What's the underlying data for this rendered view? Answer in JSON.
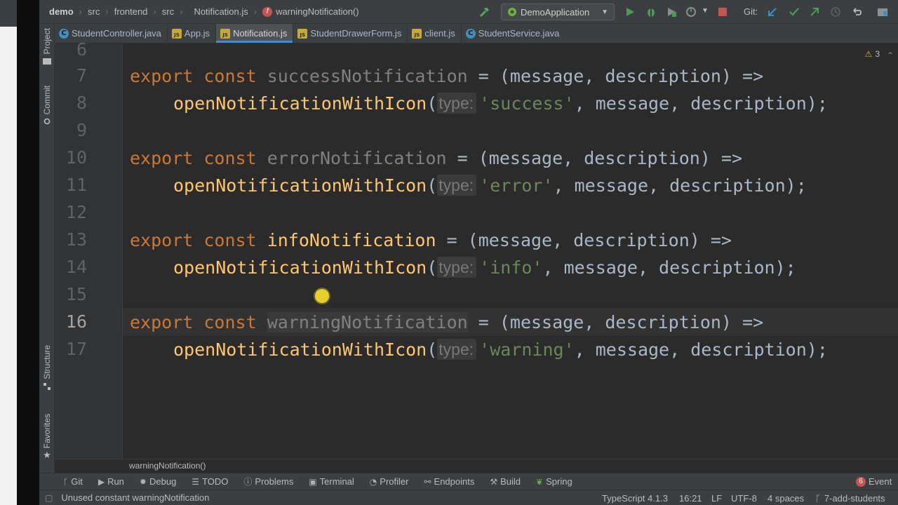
{
  "navbar": {
    "breadcrumbs": [
      "demo",
      "src",
      "frontend",
      "src",
      "Notification.js",
      "warningNotification()"
    ],
    "run_config": "DemoApplication",
    "git_label": "Git:"
  },
  "tabs": [
    {
      "label": "StudentController.java",
      "icon": "C"
    },
    {
      "label": "App.js",
      "icon": "JS"
    },
    {
      "label": "Notification.js",
      "icon": "JS",
      "active": true
    },
    {
      "label": "StudentDrawerForm.js",
      "icon": "JS"
    },
    {
      "label": "client.js",
      "icon": "JS"
    },
    {
      "label": "StudentService.java",
      "icon": "C"
    }
  ],
  "side_tools": {
    "project": "Project",
    "commit": "Commit",
    "structure": "Structure",
    "favorites": "Favorites"
  },
  "editor": {
    "line_numbers": [
      "6",
      "7",
      "8",
      "9",
      "10",
      "11",
      "12",
      "13",
      "14",
      "15",
      "16",
      "17"
    ],
    "param_hint": "type:",
    "kw_export": "export",
    "kw_const": "const",
    "params": " = (message, description) =>",
    "call": "openNotificationWithIcon",
    "call_args_tail": ", message, description);",
    "lines": {
      "l7_name": "successNotification",
      "l8_str": "'success'",
      "l10_name": "errorNotification",
      "l11_str": "'error'",
      "l13_name": "infoNotification",
      "l14_str": "'info'",
      "l16_name": "warningNotification",
      "l17_str": "'warning'"
    },
    "warnings_count": "3"
  },
  "code_breadcrumb": "warningNotification()",
  "bottom_tools": [
    "Git",
    "Run",
    "Debug",
    "TODO",
    "Problems",
    "Terminal",
    "Profiler",
    "Endpoints",
    "Build",
    "Spring"
  ],
  "event_log": {
    "count": "6",
    "label": "Event"
  },
  "status": {
    "message": "Unused constant warningNotification",
    "language": "TypeScript 4.1.3",
    "position": "16:21",
    "line_sep": "LF",
    "encoding": "UTF-8",
    "indent": "4 spaces",
    "branch": "7-add-students"
  },
  "colors": {
    "keyword": "#cc7832",
    "function": "#ffc66d",
    "string": "#6a8759",
    "unused": "#808080",
    "text": "#a9b7c6",
    "editor_bg": "#2b2b2b",
    "tab_accent": "#4a88c7"
  }
}
